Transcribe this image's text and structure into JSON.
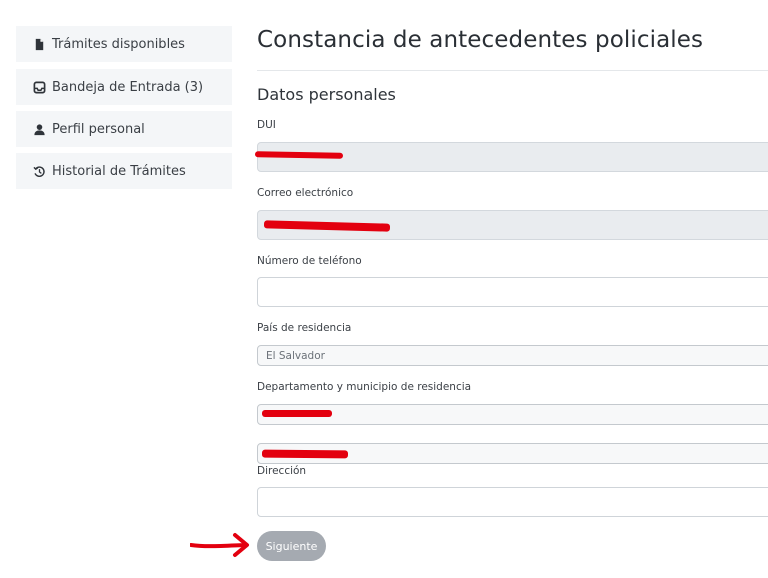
{
  "sidebar": {
    "items": [
      {
        "label": "Trámites disponibles",
        "icon": "document-icon"
      },
      {
        "label": "Bandeja de Entrada (3)",
        "icon": "inbox-icon"
      },
      {
        "label": "Perfil personal",
        "icon": "person-icon"
      },
      {
        "label": "Historial de Trámites",
        "icon": "history-icon"
      }
    ]
  },
  "page": {
    "title": "Constancia de antecedentes policiales",
    "section_title": "Datos personales"
  },
  "form": {
    "dui_label": "DUI",
    "email_label": "Correo electrónico",
    "phone_label": "Número de teléfono",
    "phone_value": "",
    "country_label": "País de residencia",
    "country_value": "El Salvador",
    "dept_label": "Departamento y municipio de residencia",
    "address_label": "Dirección",
    "address_value": ""
  },
  "actions": {
    "next_label": "Siguiente"
  },
  "colors": {
    "redaction": "#e3000f",
    "button_bg": "#a5aab1",
    "sidebar_bg": "#f4f6f8"
  }
}
